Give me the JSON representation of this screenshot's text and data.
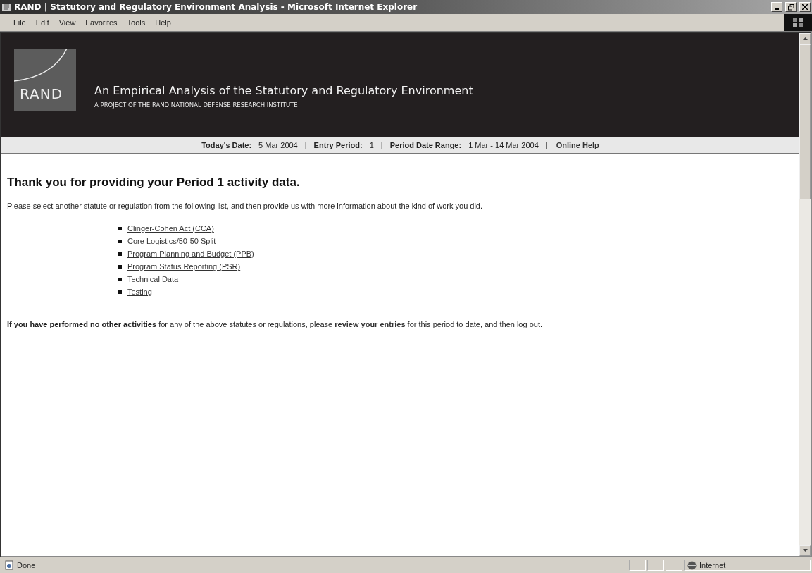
{
  "window": {
    "title": "RAND | Statutory and Regulatory Environment Analysis - Microsoft Internet Explorer"
  },
  "menu": [
    "File",
    "Edit",
    "View",
    "Favorites",
    "Tools",
    "Help"
  ],
  "header": {
    "logo": "RAND",
    "title": "An Empirical Analysis of the Statutory and Regulatory Environment",
    "subtitle": "A PROJECT OF THE RAND NATIONAL DEFENSE RESEARCH INSTITUTE"
  },
  "info_bar": {
    "items": [
      {
        "label": "Today's Date:",
        "value": "5 Mar 2004",
        "separator": "|"
      },
      {
        "label": "Entry Period:",
        "value": "1",
        "separator": "|"
      },
      {
        "label": "Period Date Range:",
        "value": "1 Mar - 14 Mar 2004",
        "separator": "|"
      }
    ],
    "help_link": "Online Help"
  },
  "heading": "Thank you for providing your Period 1 activity data.",
  "intro": "Please select another statute or regulation from the following list, and then provide us with more information about the kind of work you did.",
  "statutes": [
    "Clinger-Cohen Act (CCA)",
    "Core Logistics/50-50 Split",
    "Program Planning and Budget (PPB)",
    "Program Status Reporting (PSR)",
    "Technical Data",
    "Testing"
  ],
  "closing": {
    "before": "**If you have performed no other activities** for any of the above statutes or regulations, please ",
    "link": "review your entries",
    "after": " for this period to date, and then log out."
  },
  "status_bar": {
    "status": "Done",
    "zone": "Internet"
  }
}
